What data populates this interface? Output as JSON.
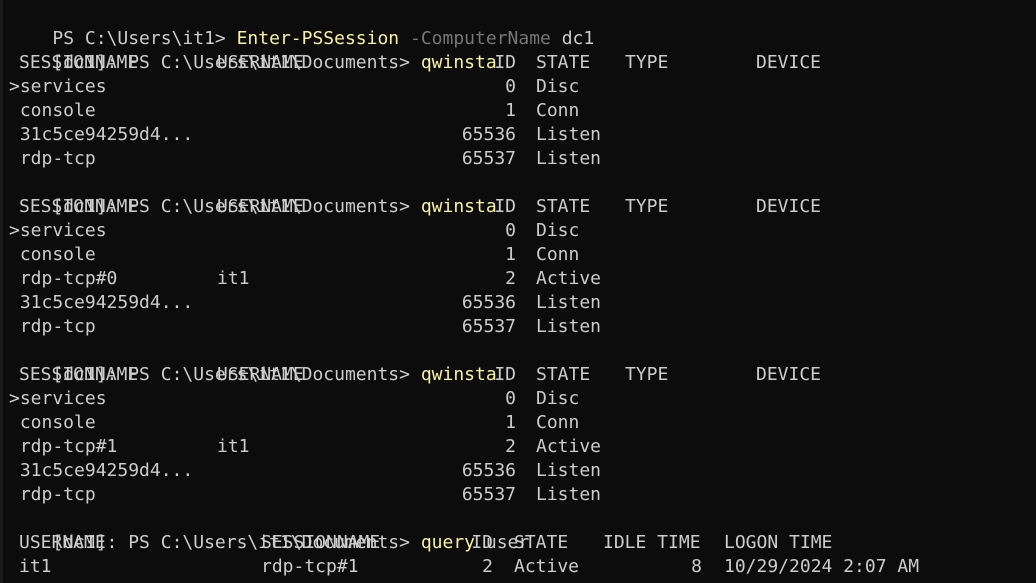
{
  "colors": {
    "background": "#0c0c0c",
    "text": "#cccccc",
    "command": "#f9f1a5",
    "parameter": "#767676"
  },
  "terminal": {
    "line1": {
      "prompt": "PS C:\\Users\\it1> ",
      "command": "Enter-PSSession",
      "param": " -ComputerName",
      "arg": " dc1"
    },
    "prompts": {
      "remote": "[dc1]: PS C:\\Users\\it1\\Documents> "
    },
    "cmd_qwinsta": "qwinsta",
    "cmd_query": "query",
    "cmd_query_arg": " user",
    "qwinsta_headers": {
      "sessionname": "SESSIONNAME",
      "username": "USERNAME",
      "id": "ID",
      "state": "STATE",
      "type": "TYPE",
      "device": "DEVICE"
    },
    "qwinsta_blocks": [
      {
        "rows": [
          {
            "session": ">services",
            "user": "",
            "id": "0",
            "state": "Disc"
          },
          {
            "session": " console",
            "user": "",
            "id": "1",
            "state": "Conn"
          },
          {
            "session": " 31c5ce94259d4...",
            "user": "",
            "id": "65536",
            "state": "Listen"
          },
          {
            "session": " rdp-tcp",
            "user": "",
            "id": "65537",
            "state": "Listen"
          }
        ]
      },
      {
        "rows": [
          {
            "session": ">services",
            "user": "",
            "id": "0",
            "state": "Disc"
          },
          {
            "session": " console",
            "user": "",
            "id": "1",
            "state": "Conn"
          },
          {
            "session": " rdp-tcp#0",
            "user": "it1",
            "id": "2",
            "state": "Active"
          },
          {
            "session": " 31c5ce94259d4...",
            "user": "",
            "id": "65536",
            "state": "Listen"
          },
          {
            "session": " rdp-tcp",
            "user": "",
            "id": "65537",
            "state": "Listen"
          }
        ]
      },
      {
        "rows": [
          {
            "session": ">services",
            "user": "",
            "id": "0",
            "state": "Disc"
          },
          {
            "session": " console",
            "user": "",
            "id": "1",
            "state": "Conn"
          },
          {
            "session": " rdp-tcp#1",
            "user": "it1",
            "id": "2",
            "state": "Active"
          },
          {
            "session": " 31c5ce94259d4...",
            "user": "",
            "id": "65536",
            "state": "Listen"
          },
          {
            "session": " rdp-tcp",
            "user": "",
            "id": "65537",
            "state": "Listen"
          }
        ]
      }
    ],
    "query_headers": {
      "username": "USERNAME",
      "sessionname": "SESSIONNAME",
      "id": "ID",
      "state": "STATE",
      "idle": "IDLE TIME",
      "logon": "LOGON TIME"
    },
    "query_rows": [
      {
        "username": "it1",
        "sessionname": "rdp-tcp#1",
        "id": "2",
        "state": "Active",
        "idle": "8",
        "logon": "10/29/2024 2:07 AM"
      }
    ]
  }
}
